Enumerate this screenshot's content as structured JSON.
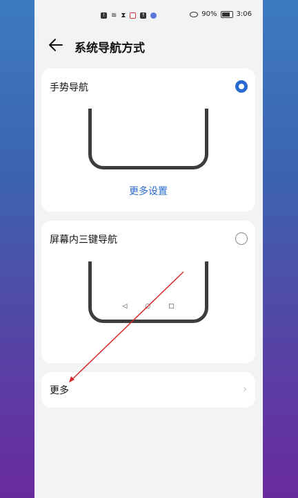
{
  "status_bar": {
    "battery": "90%",
    "time": "3:06"
  },
  "header": {
    "title": "系统导航方式"
  },
  "options": [
    {
      "label": "手势导航",
      "selected": true,
      "action": "更多设置"
    },
    {
      "label": "屏幕内三键导航",
      "selected": false,
      "nav_keys": [
        "◁",
        "○",
        "□"
      ]
    }
  ],
  "more": {
    "label": "更多"
  },
  "colors": {
    "accent": "#2a6ad0",
    "annotation": "#d62a2a"
  }
}
